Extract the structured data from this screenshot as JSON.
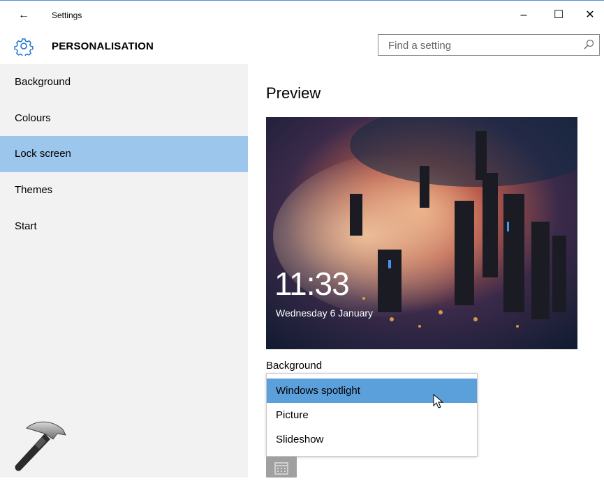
{
  "window": {
    "title": "Settings",
    "back_icon": "←",
    "minimize_icon": "–",
    "maximize_icon": "☐",
    "close_icon": "✕"
  },
  "header": {
    "section_title": "PERSONALISATION",
    "search_placeholder": "Find a setting"
  },
  "sidebar": {
    "items": [
      {
        "label": "Background",
        "selected": false
      },
      {
        "label": "Colours",
        "selected": false
      },
      {
        "label": "Lock screen",
        "selected": true
      },
      {
        "label": "Themes",
        "selected": false
      },
      {
        "label": "Start",
        "selected": false
      }
    ]
  },
  "main": {
    "preview_title": "Preview",
    "clock_time": "11:33",
    "clock_date": "Wednesday 6 January",
    "background_label": "Background",
    "background_options": [
      {
        "label": "Windows spotlight",
        "selected": true
      },
      {
        "label": "Picture",
        "selected": false
      },
      {
        "label": "Slideshow",
        "selected": false
      }
    ]
  },
  "colors": {
    "sidebar_bg": "#f2f2f2",
    "selected_nav": "#9cc6ec",
    "selected_option": "#5b9fdb",
    "accent": "#1e73c8"
  }
}
